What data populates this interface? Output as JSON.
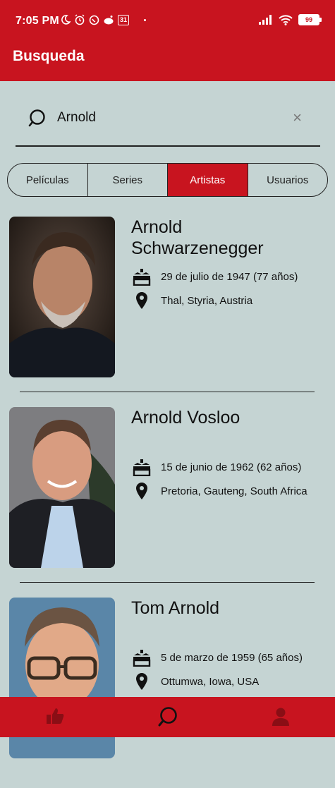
{
  "status": {
    "time": "7:05 PM",
    "calendar_day": "31",
    "battery": "99"
  },
  "appbar": {
    "title": "Busqueda"
  },
  "search": {
    "value": "Arnold",
    "clear_icon": "×"
  },
  "tabs": [
    {
      "label": "Películas",
      "active": false
    },
    {
      "label": "Series",
      "active": false
    },
    {
      "label": "Artistas",
      "active": true
    },
    {
      "label": "Usuarios",
      "active": false
    }
  ],
  "results": [
    {
      "name_line1": "Arnold",
      "name_line2": "Schwarzenegger",
      "birth": "29 de julio de 1947 (77 años)",
      "place": "Thal, Styria, Austria"
    },
    {
      "name_line1": "Arnold Vosloo",
      "name_line2": "",
      "birth": "15 de junio de 1962 (62 años)",
      "place": "Pretoria, Gauteng, South Africa"
    },
    {
      "name_line1": "Tom Arnold",
      "name_line2": "",
      "birth": "5 de marzo de 1959 (65 años)",
      "place": "Ottumwa, Iowa, USA"
    }
  ],
  "colors": {
    "primary": "#c8141f",
    "background": "#c5d4d3",
    "nav_inactive": "#8a0e15"
  },
  "bottom_nav": [
    "thumbs-up-icon",
    "search-icon",
    "person-icon"
  ]
}
